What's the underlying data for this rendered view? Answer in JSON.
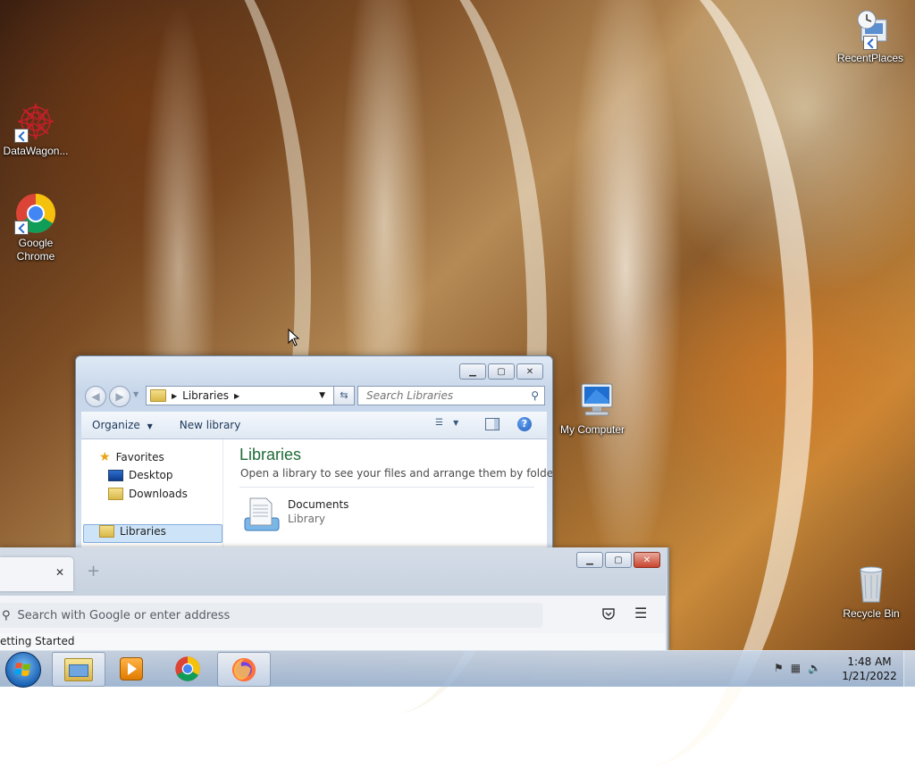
{
  "desktop": {
    "icons": [
      {
        "label": "DataWagon...",
        "icon": "datawagon-icon"
      },
      {
        "label": "Google Chrome",
        "label_line1": "Google",
        "label_line2": "Chrome",
        "icon": "chrome-icon"
      },
      {
        "label": "RecentPlaces",
        "icon": "recent-places-icon"
      },
      {
        "label": "My Computer",
        "icon": "computer-icon"
      },
      {
        "label": "Recycle Bin",
        "icon": "recycle-bin-icon"
      }
    ]
  },
  "explorer": {
    "address": {
      "crumb": "Libraries"
    },
    "search_placeholder": "Search Libraries",
    "toolbar": {
      "organize": "Organize",
      "new_library": "New library"
    },
    "nav": {
      "favorites": "Favorites",
      "desktop": "Desktop",
      "downloads": "Downloads",
      "libraries": "Libraries"
    },
    "main": {
      "title": "Libraries",
      "subtitle": "Open a library to see your files and arrange them by folde...",
      "items": [
        {
          "name": "Documents",
          "type": "Library"
        }
      ]
    },
    "colors": {
      "title": "#1e6a37",
      "accent": "#1e395b"
    }
  },
  "firefox": {
    "new_tab_symbol": "+",
    "close_tab_symbol": "✕",
    "url_placeholder": "Search with Google or enter address",
    "bookmark": "etting Started"
  },
  "taskbar": {
    "time": "1:48 AM",
    "date": "1/21/2022",
    "pinned": [
      "explorer-icon",
      "media-player-icon",
      "chrome-icon",
      "firefox-icon"
    ]
  }
}
